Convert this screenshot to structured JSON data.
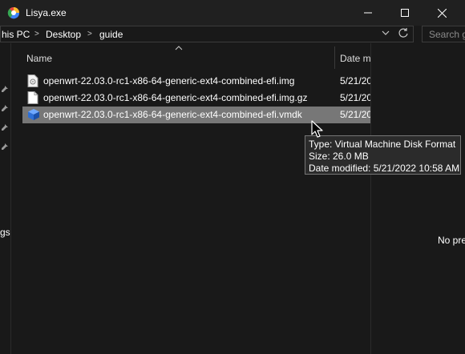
{
  "window": {
    "title": "Lisya.exe",
    "icon": "colorful-app-icon"
  },
  "address": {
    "crumbs": [
      "his PC",
      "Desktop",
      "guide"
    ],
    "separator": ">"
  },
  "search": {
    "placeholder": "Search g"
  },
  "nav_pane": {
    "partial_label": "gs",
    "pin_icons": 4
  },
  "file_list": {
    "columns": {
      "name": "Name",
      "date": "Date m"
    },
    "rows": [
      {
        "name": "openwrt-22.03.0-rc1-x86-64-generic-ext4-combined-efi.img",
        "date": "5/21/202",
        "icon": "disk-image-file-icon",
        "selected": false
      },
      {
        "name": "openwrt-22.03.0-rc1-x86-64-generic-ext4-combined-efi.img.gz",
        "date": "5/21/202",
        "icon": "blank-file-icon",
        "selected": false
      },
      {
        "name": "openwrt-22.03.0-rc1-x86-64-generic-ext4-combined-efi.vmdk",
        "date": "5/21/202",
        "icon": "virtual-disk-file-icon",
        "selected": true
      }
    ]
  },
  "tooltip": {
    "type": "Type: Virtual Machine Disk Format",
    "size": "Size: 26.0 MB",
    "modified": "Date modified: 5/21/2022 10:58 AM"
  },
  "preview": {
    "text": "No pre"
  },
  "colors": {
    "selection": "#777777",
    "background": "#191919",
    "titlebar": "#202020"
  }
}
